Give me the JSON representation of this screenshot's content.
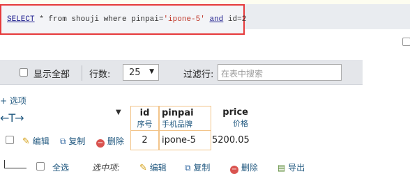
{
  "sql": {
    "kw_select": "SELECT",
    "rest1": " * from shouji where pinpai=",
    "str": "'ipone-5'",
    "sp": " ",
    "kw_and": "and",
    "rest2": " id=2"
  },
  "toolbar": {
    "show_all_label": "显示全部",
    "rows_label": "行数:",
    "rows_value": "25",
    "filter_label": "过滤行:",
    "filter_placeholder": "在表中搜索"
  },
  "options_label": "+ 选项",
  "sort_arrows": "←T→",
  "columns": [
    {
      "name": "id",
      "comment": "序号"
    },
    {
      "name": "pinpai",
      "comment": "手机品牌"
    },
    {
      "name": "price",
      "comment": "价格"
    }
  ],
  "row": {
    "edit_label": "编辑",
    "copy_label": "复制",
    "delete_label": "删除",
    "id": "2",
    "pinpai": "ipone-5",
    "price": "5200.05"
  },
  "footer": {
    "select_all_label": "全选",
    "selected_label": "选中项:",
    "edit_label": "编辑",
    "copy_label": "复制",
    "delete_label": "删除",
    "export_label": "导出"
  },
  "colors": {
    "highlight_border": "#e6393a",
    "link": "#235a81",
    "column_highlight": "#f2c48a"
  }
}
